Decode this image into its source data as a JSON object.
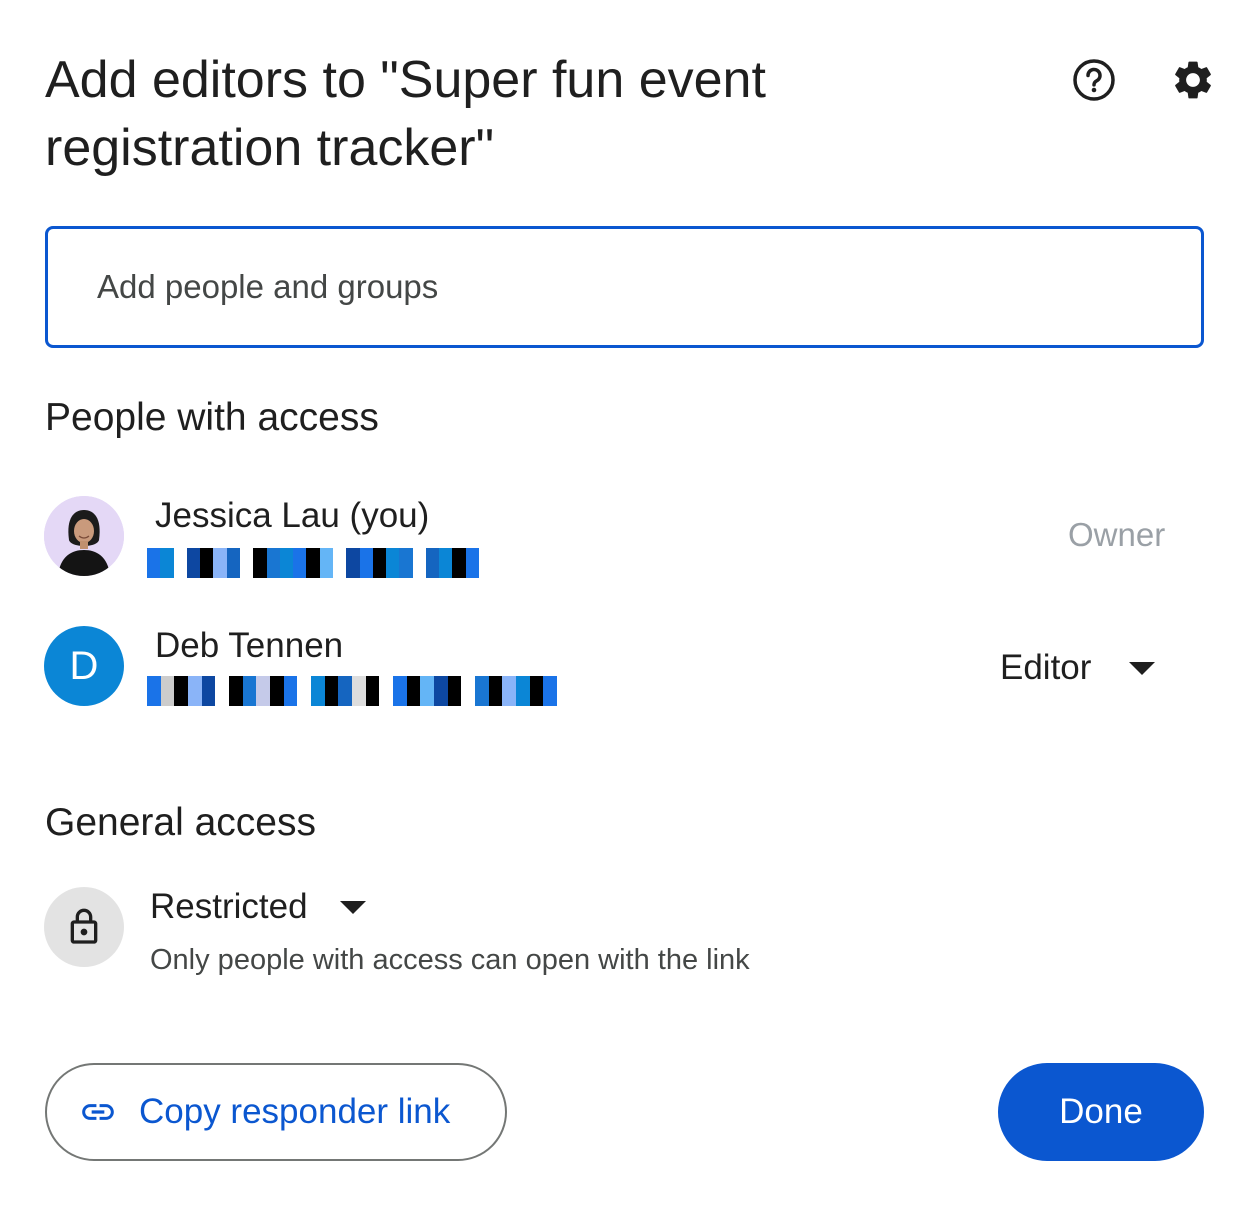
{
  "dialog": {
    "title": "Add editors to \"Super fun event registration tracker\"",
    "help_icon": "help-circle-icon",
    "settings_icon": "gear-icon"
  },
  "search": {
    "placeholder": "Add people and groups",
    "value": ""
  },
  "people": {
    "heading": "People with access",
    "list": [
      {
        "name": "Jessica Lau (you)",
        "avatar": "photo",
        "role": "Owner",
        "email_redacted": true
      },
      {
        "name": "Deb Tennen",
        "avatar_letter": "D",
        "role": "Editor",
        "email_redacted": true
      }
    ]
  },
  "general_access": {
    "heading": "General access",
    "icon": "lock-icon",
    "level": "Restricted",
    "description": "Only people with access can open with the link"
  },
  "footer": {
    "copy_link_label": "Copy responder link",
    "copy_link_icon": "link-icon",
    "done_label": "Done"
  },
  "colors": {
    "accent": "#0b57d0",
    "avatar_d": "#0b86d6",
    "muted": "#9aa0a6"
  }
}
